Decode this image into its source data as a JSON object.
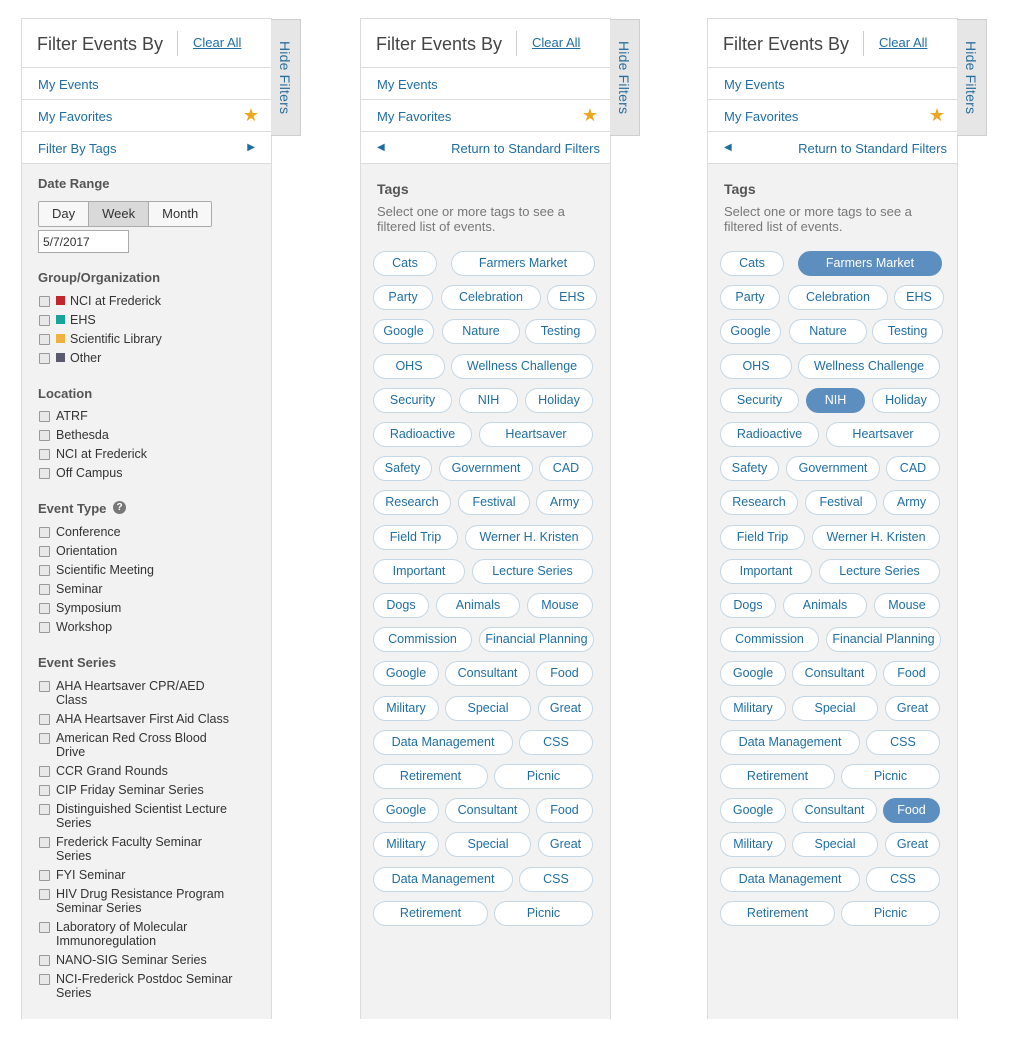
{
  "panel1": {
    "title": "Filter Events By",
    "clear_all": "Clear All",
    "hide_filters": "Hide Filters",
    "my_events": "My Events",
    "my_favorites": "My Favorites",
    "filter_by_tags": "Filter By Tags",
    "date_range": {
      "title": "Date Range",
      "options": [
        "Day",
        "Week",
        "Month"
      ],
      "selected": "Week",
      "date_value": "5/7/2017"
    },
    "group": {
      "title": "Group/Organization",
      "items": [
        {
          "label": "NCI at Frederick",
          "color": "#c0272d"
        },
        {
          "label": "EHS",
          "color": "#1aa39a"
        },
        {
          "label": "Scientific Library",
          "color": "#f0b23e"
        },
        {
          "label": "Other",
          "color": "#5a5a6e"
        }
      ]
    },
    "location": {
      "title": "Location",
      "items": [
        "ATRF",
        "Bethesda",
        "NCI at Frederick",
        "Off Campus"
      ]
    },
    "event_type": {
      "title": "Event Type",
      "help": "?",
      "items": [
        "Conference",
        "Orientation",
        "Scientific Meeting",
        "Seminar",
        "Symposium",
        "Workshop"
      ]
    },
    "event_series": {
      "title": "Event Series",
      "items": [
        [
          "AHA Heartsaver CPR/AED",
          "Class"
        ],
        [
          "AHA Heartsaver First Aid Class"
        ],
        [
          "American Red Cross Blood",
          "Drive"
        ],
        [
          "CCR Grand Rounds"
        ],
        [
          "CIP Friday Seminar Series"
        ],
        [
          "Distinguished Scientist Lecture",
          "Series"
        ],
        [
          "Frederick Faculty Seminar",
          "Series"
        ],
        [
          "FYI Seminar"
        ],
        [
          "HIV Drug Resistance Program",
          "Seminar Series"
        ],
        [
          "Laboratory of Molecular",
          "Immunoregulation"
        ],
        [
          "NANO-SIG Seminar Series"
        ],
        [
          "NCI-Frederick Postdoc Seminar",
          "Series"
        ]
      ]
    }
  },
  "tag_panel": {
    "title": "Filter Events By",
    "clear_all": "Clear All",
    "hide_filters": "Hide Filters",
    "my_events": "My Events",
    "my_favorites": "My Favorites",
    "return_label": "Return to Standard Filters",
    "tags_title": "Tags",
    "tags_desc": "Select one or more tags to see a filtered list of events.",
    "tag_rows": [
      [
        "Cats",
        "Farmers Market"
      ],
      [
        "Party",
        "Celebration",
        "EHS"
      ],
      [
        "Google",
        "Nature",
        "Testing"
      ],
      [
        "OHS",
        "Wellness Challenge"
      ],
      [
        "Security",
        "NIH",
        "Holiday"
      ],
      [
        "Radioactive",
        "Heartsaver"
      ],
      [
        "Safety",
        "Government",
        "CAD"
      ],
      [
        "Research",
        "Festival",
        "Army"
      ],
      [
        "Field Trip",
        "Werner H. Kristen"
      ],
      [
        "Important",
        "Lecture Series"
      ],
      [
        "Dogs",
        "Animals",
        "Mouse"
      ],
      [
        "Commission",
        "Financial Planning"
      ],
      [
        "Google",
        "Consultant",
        "Food"
      ],
      [
        "Military",
        "Special",
        "Great"
      ],
      [
        "Data Management",
        "CSS"
      ],
      [
        "Retirement",
        "Picnic"
      ],
      [
        "Google",
        "Consultant",
        "Food"
      ],
      [
        "Military",
        "Special",
        "Great"
      ],
      [
        "Data Management",
        "CSS"
      ],
      [
        "Retirement",
        "Picnic"
      ]
    ]
  },
  "panel3_selected_tags": [
    "Farmers Market",
    "NIH",
    "Food (row 17)"
  ],
  "colors": {
    "link": "#1f6ea3",
    "selected_tag": "#5c8fc0",
    "star": "#eca61f"
  }
}
